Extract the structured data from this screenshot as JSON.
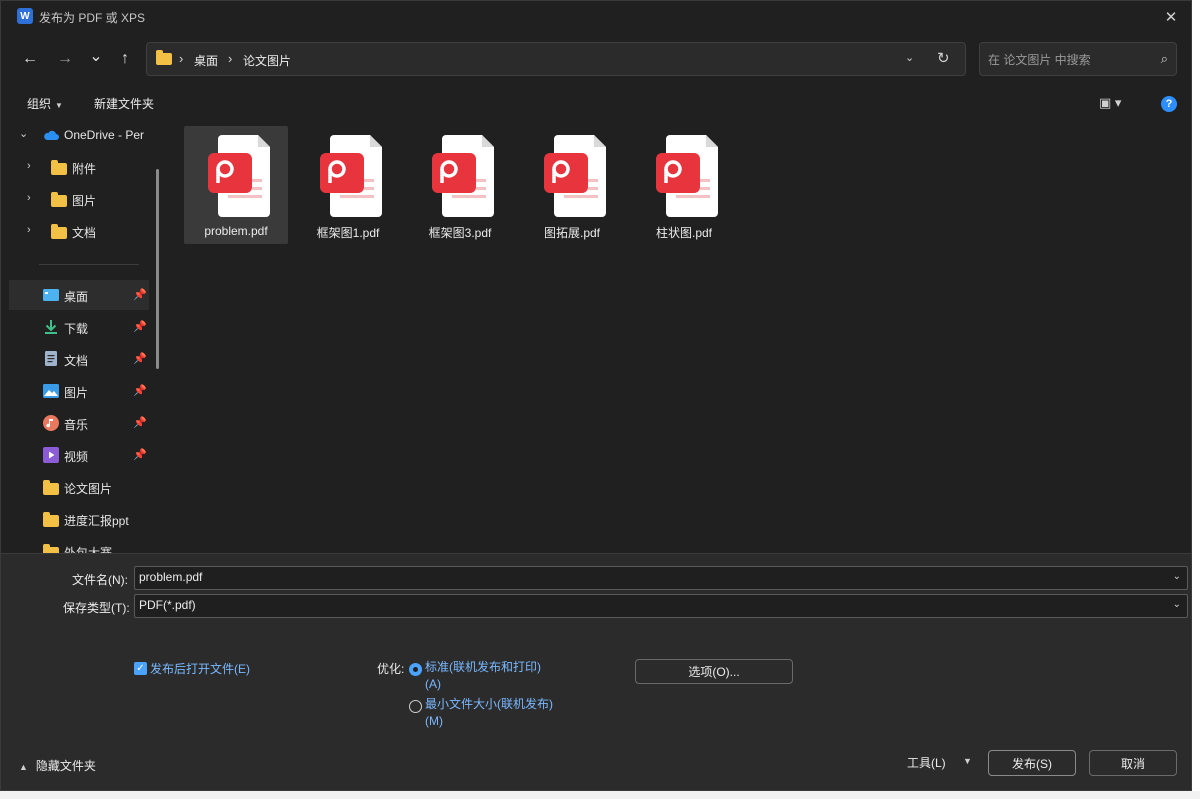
{
  "window": {
    "title": "发布为 PDF 或 XPS",
    "app_icon_text": "W",
    "close_glyph": "✕"
  },
  "nav": {
    "back_glyph": "←",
    "forward_glyph": "→",
    "recent_glyph": "⌄",
    "up_glyph": "↑",
    "breadcrumb": [
      "桌面",
      "论文图片"
    ],
    "crumb_sep": "›",
    "dropdown_glyph": "⌄",
    "refresh_glyph": "↻",
    "search_placeholder": "在 论文图片 中搜索",
    "search_glyph": "⌕"
  },
  "toolbar": {
    "organize_label": "组织",
    "organize_caret": "▼",
    "new_folder_label": "新建文件夹",
    "view_glyph": "▣ ▾",
    "help_glyph": "?"
  },
  "sidebar": {
    "onedrive": {
      "label": "OneDrive - Per",
      "chev": "⌄",
      "icon": "cloud-icon"
    },
    "tree": [
      {
        "label": "附件",
        "chev": "›",
        "icon": "folder-icon"
      },
      {
        "label": "图片",
        "chev": "›",
        "icon": "folder-icon"
      },
      {
        "label": "文档",
        "chev": "›",
        "icon": "folder-icon"
      }
    ],
    "quick": [
      {
        "label": "桌面",
        "icon": "desktop-icon",
        "pinned": true,
        "selected": true
      },
      {
        "label": "下载",
        "icon": "download-icon",
        "pinned": true
      },
      {
        "label": "文档",
        "icon": "document-icon",
        "pinned": true
      },
      {
        "label": "图片",
        "icon": "picture-icon",
        "pinned": true
      },
      {
        "label": "音乐",
        "icon": "music-icon",
        "pinned": true
      },
      {
        "label": "视频",
        "icon": "video-icon",
        "pinned": true
      },
      {
        "label": "论文图片",
        "icon": "folder-icon"
      },
      {
        "label": "进度汇报ppt",
        "icon": "folder-icon"
      },
      {
        "label": "外包大赛",
        "icon": "folder-icon"
      }
    ],
    "pin_glyph": "📌"
  },
  "files": [
    {
      "name": "problem.pdf",
      "selected": true
    },
    {
      "name": "框架图1.pdf"
    },
    {
      "name": "框架图3.pdf"
    },
    {
      "name": "图拓展.pdf"
    },
    {
      "name": "柱状图.pdf"
    }
  ],
  "form": {
    "filename_label": "文件名(N):",
    "filename_value": "problem.pdf",
    "filetype_label": "保存类型(T):",
    "filetype_value": "PDF(*.pdf)",
    "caret_glyph": "⌄",
    "open_after_label": "发布后打开文件(E)",
    "check_glyph": "✓",
    "optimize_label": "优化:",
    "radio_standard": "标准(联机发布和打印)(A)",
    "radio_minimum": "最小文件大小(联机发布)(M)",
    "options_button": "选项(O)...",
    "tools_label": "工具(L)",
    "tools_caret": "▼",
    "publish_button": "发布(S)",
    "cancel_button": "取消",
    "hide_folders_label": "隐藏文件夹",
    "hide_folders_glyph": "▲"
  },
  "colors": {
    "accent": "#4aa3ff",
    "folder": "#f3c046",
    "pdf_red": "#e8343c"
  }
}
